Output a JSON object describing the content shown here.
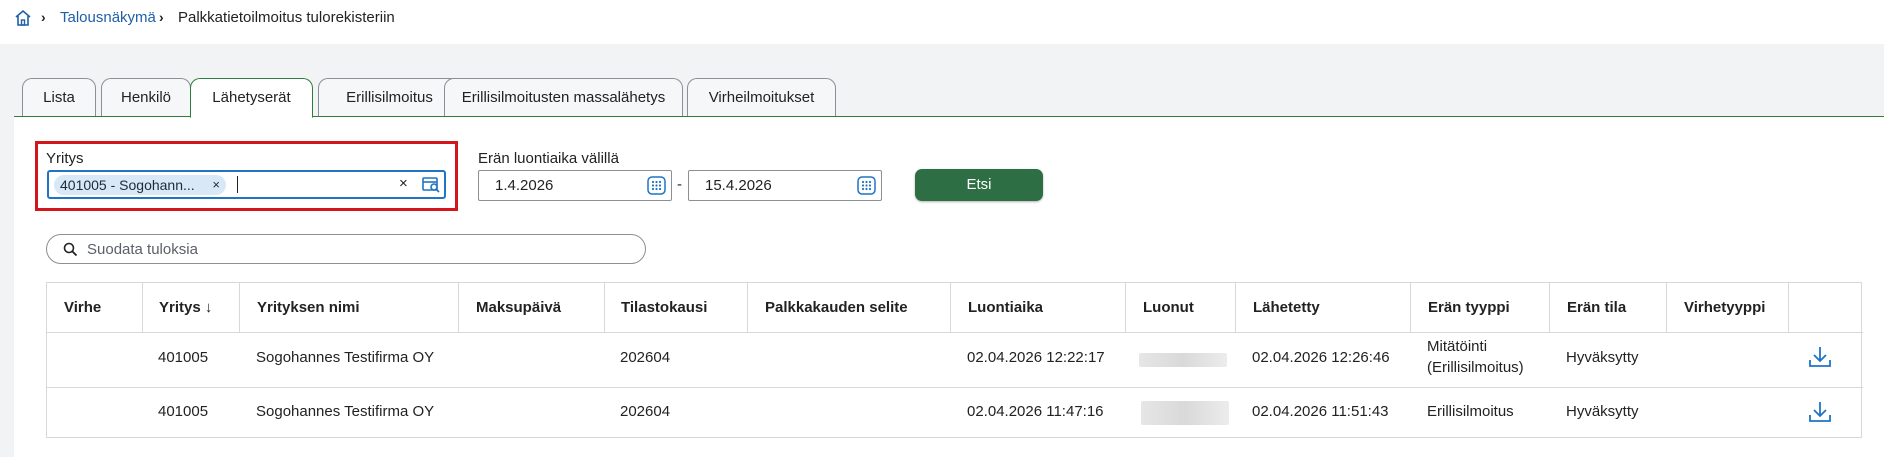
{
  "breadcrumb": {
    "home_icon": "home-icon",
    "items": [
      "Talousnäkymä",
      "Palkkatietoilmoitus tulorekisteriin"
    ]
  },
  "tabs": [
    "Lista",
    "Henkilö",
    "Lähetyserät",
    "Erillisilmoitus",
    "Erillisilmoitusten massalähetys",
    "Virheilmoitukset"
  ],
  "active_tab": "Lähetyserät",
  "search_form": {
    "yritys_label": "Yritys",
    "yritys_chip": "401005 - Sogohann...",
    "yritys_chip_remove": "×",
    "yritys_clear": "×",
    "date_range_label": "Erän luontiaika välillä",
    "date_from": "1.4.2026",
    "date_separator": "-",
    "date_to": "15.4.2026",
    "search_button": "Etsi"
  },
  "filter": {
    "placeholder": "Suodata tuloksia"
  },
  "table": {
    "columns": [
      "Virhe",
      "Yritys",
      "Yrityksen nimi",
      "Maksupäivä",
      "Tilastokausi",
      "Palkkakauden selite",
      "Luontiaika",
      "Luonut",
      "Lähetetty",
      "Erän tyyppi",
      "Erän tila",
      "Virhetyyppi"
    ],
    "sort_indicator": "↓",
    "rows": [
      {
        "virhe": "",
        "yritys": "401005",
        "nimi": "Sogohannes Testifirma OY",
        "maksupaiva": "",
        "tilastokausi": "202604",
        "selite": "",
        "luontiaika": "02.04.2026 12:22:17",
        "luonut": "",
        "lahetetty": "02.04.2026 12:26:46",
        "tyyppi_line1": "Mitätöinti",
        "tyyppi_line2": "(Erillisilmoitus)",
        "tila": "Hyväksytty",
        "virhetyyppi": ""
      },
      {
        "virhe": "",
        "yritys": "401005",
        "nimi": "Sogohannes Testifirma OY",
        "maksupaiva": "",
        "tilastokausi": "202604",
        "selite": "",
        "luontiaika": "02.04.2026 11:47:16",
        "luonut": "",
        "lahetetty": "02.04.2026 11:51:43",
        "tyyppi_line1": "Erillisilmoitus",
        "tyyppi_line2": "",
        "tila": "Hyväksytty",
        "virhetyyppi": ""
      }
    ]
  },
  "colors": {
    "accent_green": "#2e6e44",
    "link_blue": "#1f5fa8",
    "highlight_red": "#d3151c",
    "tab_border_active": "#2e7d3f"
  }
}
